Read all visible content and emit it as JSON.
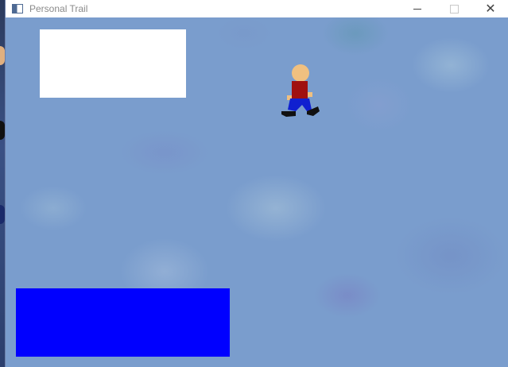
{
  "window": {
    "title": "Personal Trail",
    "controls": {
      "minimize": "minimize",
      "maximize": "maximize",
      "close": "✕"
    }
  },
  "game": {
    "player": {
      "skin_color": "#f0c080",
      "shirt_color": "#a01010",
      "pants_color": "#1020d0",
      "shoe_color": "#111111"
    },
    "panels": {
      "white_box_color": "#ffffff",
      "blue_box_color": "#0000ff"
    }
  },
  "colors": {
    "background": "#7a9dcd"
  }
}
